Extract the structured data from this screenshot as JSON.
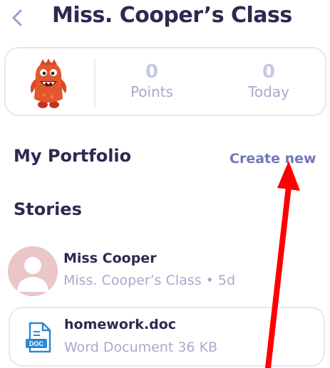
{
  "header": {
    "title": "Miss. Cooper’s Class",
    "back_icon": "chevron-left-icon"
  },
  "stats": {
    "avatar": "red-monster-avatar",
    "points_value": "0",
    "points_label": "Points",
    "today_value": "0",
    "today_label": "Today"
  },
  "portfolio": {
    "title": "My Portfolio",
    "create_label": "Create new"
  },
  "stories": {
    "title": "Stories",
    "post": {
      "author": "Miss Cooper",
      "meta": "Miss. Cooper’s Class • 5d",
      "avatar_icon": "user-silhouette-icon"
    },
    "attachment": {
      "file_name": "homework.doc",
      "file_meta": "Word Document 36 KB",
      "icon": "doc-file-icon",
      "icon_text": "DOC"
    }
  },
  "annotation": {
    "arrow_color": "#ff0000"
  },
  "colors": {
    "text_dark": "#2c2a50",
    "text_muted": "#a6abcc",
    "accent": "#7178b8",
    "doc_blue": "#2b8ad1"
  }
}
